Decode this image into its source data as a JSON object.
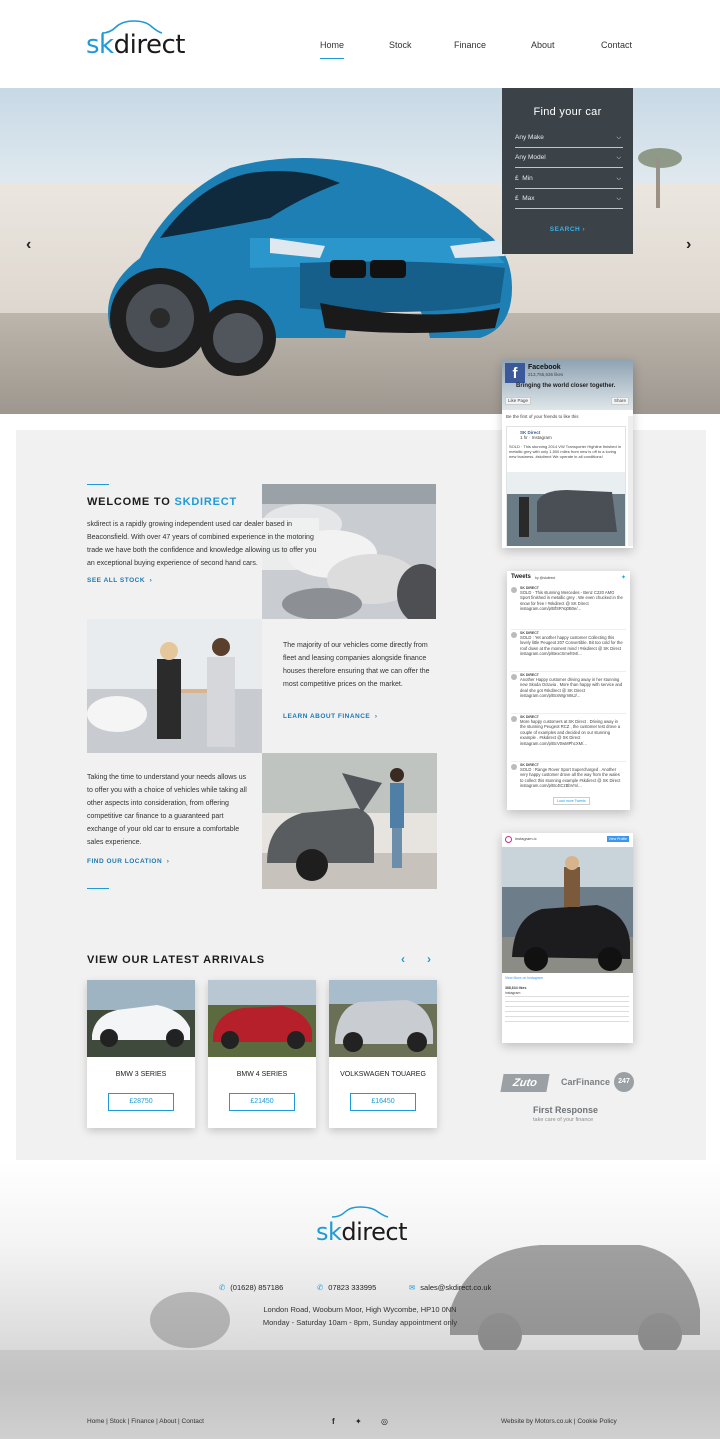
{
  "header": {
    "logo_sk": "sk",
    "logo_rest": "direct",
    "nav": [
      "Home",
      "Stock",
      "Finance",
      "About",
      "Contact"
    ]
  },
  "hero": {
    "prev": "‹",
    "next": "›"
  },
  "finder": {
    "title": "Find your car",
    "make": "Any Make",
    "model": "Any Model",
    "min_prefix": "£",
    "min": "Min",
    "max_prefix": "£",
    "max": "Max",
    "search": "SEARCH"
  },
  "welcome": {
    "title_a": "WELCOME TO ",
    "title_b": "SKDIRECT",
    "p1": "skdirect is a rapidly growing independent used car dealer based in Beaconsfield. With over 47 years of combined experience in the motoring trade we have both the confidence and knowledge allowing us to offer you an exceptional buying experience of second hand cars.",
    "cta1": "SEE ALL STOCK",
    "p2": "The majority of our vehicles come directly from fleet and leasing companies alongside finance houses therefore ensuring that we can offer the most competitive prices on the market.",
    "cta2": "LEARN ABOUT FINANCE",
    "p3": "Taking the time to understand your needs allows us to offer you with a choice of vehicles while taking all other aspects into consideration, from offering competitive car finance to a guaranteed part exchange of your old car to ensure a comfortable sales experience.",
    "cta3": "FIND OUR LOCATION"
  },
  "arrivals": {
    "title": "VIEW OUR LATEST ARRIVALS",
    "cars": [
      {
        "name": "BMW 3 SERIES",
        "price": "£28750"
      },
      {
        "name": "BMW 4 SERIES",
        "price": "£21450"
      },
      {
        "name": "VOLKSWAGEN TOUAREG",
        "price": "£16450"
      }
    ]
  },
  "facebook": {
    "page": "Facebook",
    "likes": "213,755,636 likes",
    "tagline": "Bringing the world closer together.",
    "like": "Like Page",
    "share": "Share",
    "friends": "Be the first of your friends to like this",
    "post_author": "SK Direct",
    "post_meta": "1 hr · Instagram",
    "post_text": "SOLD · This stunning 2014 VW Transporter Highline finished in metallic grey with only 1,500 miles from new is off to a loving new business. #skdirect We operate in all conditions!"
  },
  "twitter": {
    "title": "Tweets",
    "by": "by @skdirect",
    "tweets": [
      {
        "author": "SK DIRECT",
        "text": "SOLD · This stunning Mercedes - Benz C220 AMG Sport finished in metallic grey . We even chucked in the snow for free ! #skdirect @ SK Direct instagram.com/p/BfSRYq0B0e/..."
      },
      {
        "author": "SK DIRECT",
        "text": "SOLD : Yet another happy customer Collecting this lovely little Peugeot 207 Convertible. Bit too cold for the roof down at the moment mind ! #skdirect @ SK Direct instagram.com/p/BexcSmeh94/..."
      },
      {
        "author": "SK DIRECT",
        "text": "Another Happy customer driving away in her stunning new Skoda Octavia . More than happy with service and deal she got #skdirect @ SK Direct instagram.com/p/BcsWgrn8sJ/..."
      },
      {
        "author": "SK DIRECT",
        "text": "More happy customers at SK Direct . Driving away in the stunning Peugeot RCZ , the customer test drove a couple of examples and decided on our stunning example . #skdirect @ SK Direct instagram.com/p/BcV0wMPhcXM/..."
      },
      {
        "author": "SK DIRECT",
        "text": "SOLD : Range Rover Sport Supercharged . Another very happy customer drove all the way from the wales to collect this stunning example #skdirect @ SK Direct instagram.com/p/Bc4tCzBbVm/..."
      }
    ],
    "load_more": "Load more Tweets"
  },
  "instagram": {
    "handle": "instagram.ic",
    "view_profile": "View Profile",
    "link": "View More on Instagram",
    "likes": "368,634 likes",
    "user": "instagram"
  },
  "partners": [
    "Zuto",
    "CarFinance",
    "247",
    "First Response",
    "take care of your finance"
  ],
  "footer": {
    "logo_sk": "sk",
    "logo_rest": "direct",
    "phone1": "(01628) 857186",
    "phone2": "07823 333995",
    "email": "sales@skdirect.co.uk",
    "address": "London Road, Wooburn Moor, High Wycombe, HP10 0NN",
    "hours": "Monday - Saturday 10am - 8pm, Sunday appointment only",
    "links": "Home | Stock | Finance | About | Contact",
    "credit": "Website by Motors.co.uk | Cookie Policy"
  },
  "icons": [
    "chevron-left-icon",
    "chevron-right-icon",
    "chevron-down-icon",
    "phone-icon",
    "mobile-icon",
    "mail-icon",
    "facebook-icon",
    "twitter-icon",
    "instagram-icon"
  ],
  "colors": {
    "accent": "#1e9bd6",
    "panel": "#3c4348",
    "section_bg": "#f1f1f1"
  }
}
